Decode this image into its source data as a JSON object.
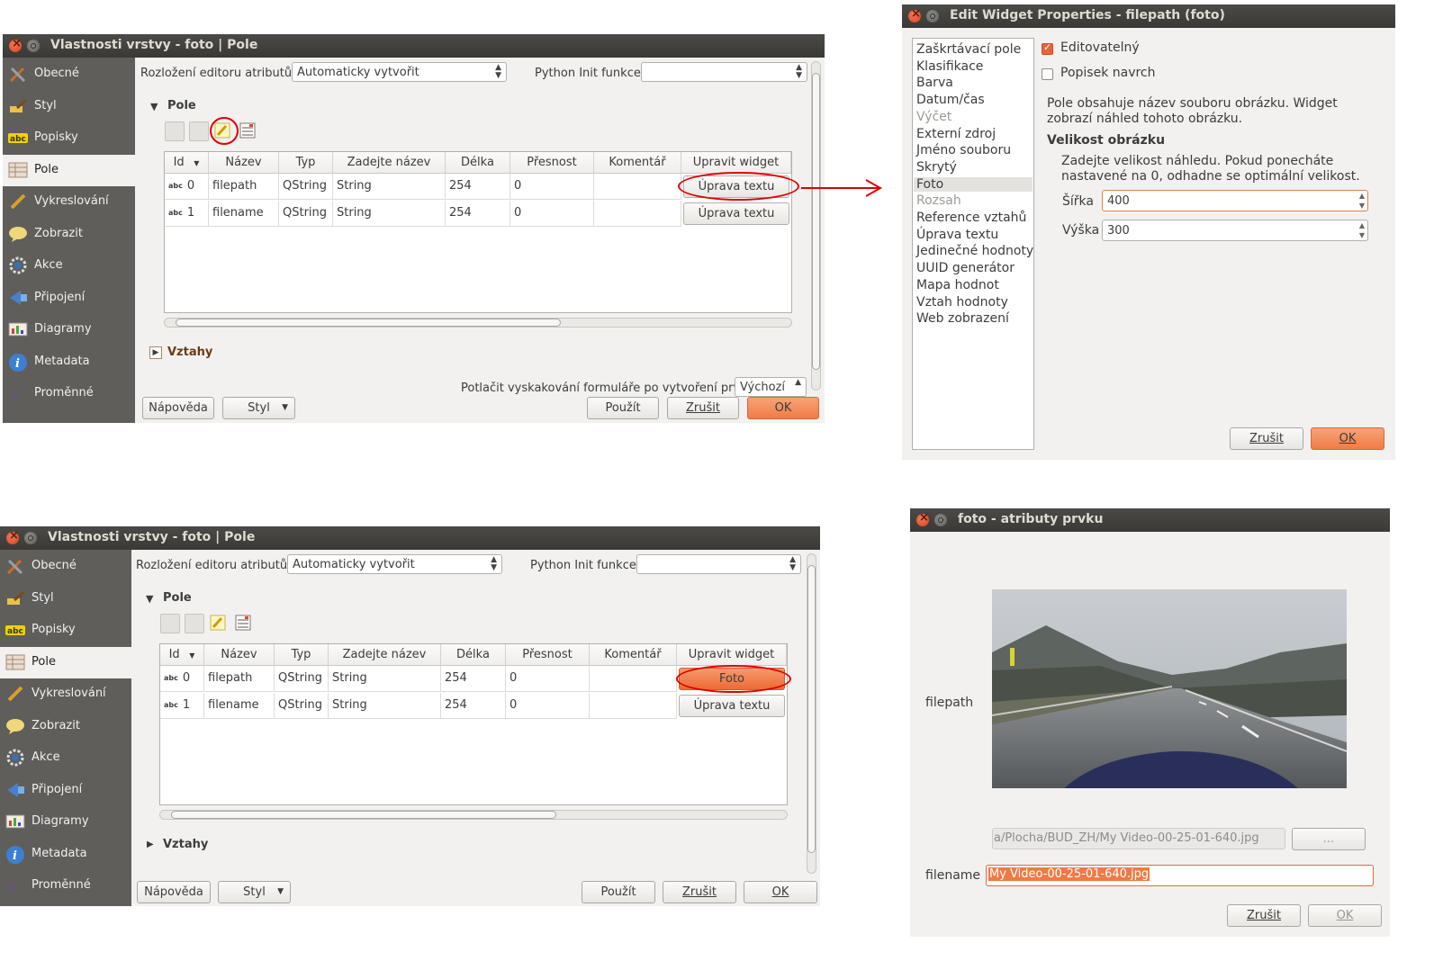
{
  "colors": {
    "titlebar": "#3c3b37",
    "sidebar": "#5f5e5a",
    "accent": "#ef7c46",
    "highlight_ring": "#e00000"
  },
  "win1": {
    "title": "Vlastnosti vrstvy - foto | Pole",
    "sidebar": [
      {
        "label": "Obecné",
        "icon": "tools-icon"
      },
      {
        "label": "Styl",
        "icon": "brush-icon"
      },
      {
        "label": "Popisky",
        "icon": "abc-label-icon"
      },
      {
        "label": "Pole",
        "icon": "table-icon"
      },
      {
        "label": "Vykreslování",
        "icon": "paintbrush-icon"
      },
      {
        "label": "Zobrazit",
        "icon": "speech-bubble-icon"
      },
      {
        "label": "Akce",
        "icon": "gear-icon"
      },
      {
        "label": "Připojení",
        "icon": "join-icon"
      },
      {
        "label": "Diagramy",
        "icon": "diagram-icon"
      },
      {
        "label": "Metadata",
        "icon": "info-icon"
      },
      {
        "label": "Proměnné",
        "icon": "epsilon-icon"
      }
    ],
    "editor_layout_label": "Rozložení editoru atributů:",
    "editor_layout_value": "Automaticky vytvořit",
    "python_init_label": "Python Init funkce",
    "python_init_value": "",
    "section_fields": "Pole",
    "section_relations": "Vztahy",
    "columns": [
      "Id",
      "Název",
      "Typ",
      "Zadejte název",
      "Délka",
      "Přesnost",
      "Komentář",
      "Upravit widget"
    ],
    "rows": [
      {
        "type_badge": "abc",
        "id": "0",
        "name": "filepath",
        "typ": "QString",
        "type_name": "String",
        "length": "254",
        "precision": "0",
        "comment": "",
        "widget": "Úprava textu"
      },
      {
        "type_badge": "abc",
        "id": "1",
        "name": "filename",
        "typ": "QString",
        "type_name": "String",
        "length": "254",
        "precision": "0",
        "comment": "",
        "widget": "Úprava textu"
      }
    ],
    "suppress_label": "Potlačit vyskakování formuláře po vytvoření prvku",
    "suppress_value": "Výchozí",
    "btn_help": "Nápověda",
    "btn_style": "Styl",
    "btn_apply": "Použít",
    "btn_cancel": "Zrušit",
    "btn_ok": "OK"
  },
  "win2": {
    "title": "Vlastnosti vrstvy - foto | Pole",
    "rows": [
      {
        "type_badge": "abc",
        "id": "0",
        "name": "filepath",
        "typ": "QString",
        "type_name": "String",
        "length": "254",
        "precision": "0",
        "comment": "",
        "widget": "Foto"
      },
      {
        "type_badge": "abc",
        "id": "1",
        "name": "filename",
        "typ": "QString",
        "type_name": "String",
        "length": "254",
        "precision": "0",
        "comment": "",
        "widget": "Úprava textu"
      }
    ]
  },
  "widget_dialog": {
    "title": "Edit Widget Properties - filepath (foto)",
    "types": [
      {
        "label": "Zaškrtávací pole",
        "enabled": true
      },
      {
        "label": "Klasifikace",
        "enabled": true
      },
      {
        "label": "Barva",
        "enabled": true
      },
      {
        "label": "Datum/čas",
        "enabled": true
      },
      {
        "label": "Výčet",
        "enabled": false
      },
      {
        "label": "Externí zdroj",
        "enabled": true
      },
      {
        "label": "Jméno souboru",
        "enabled": true
      },
      {
        "label": "Skrytý",
        "enabled": true
      },
      {
        "label": "Foto",
        "enabled": true,
        "selected": true
      },
      {
        "label": "Rozsah",
        "enabled": false
      },
      {
        "label": "Reference vztahů",
        "enabled": true
      },
      {
        "label": "Úprava textu",
        "enabled": true
      },
      {
        "label": "Jedinečné hodnoty",
        "enabled": true
      },
      {
        "label": "UUID generátor",
        "enabled": true
      },
      {
        "label": "Mapa hodnot",
        "enabled": true
      },
      {
        "label": "Vztah hodnoty",
        "enabled": true
      },
      {
        "label": "Web zobrazení",
        "enabled": true
      }
    ],
    "editable_label": "Editovatelný",
    "editable_checked": true,
    "label_on_top_label": "Popisek navrch",
    "label_on_top_checked": false,
    "description": "Pole obsahuje název souboru obrázku. Widget zobrazí náhled tohoto obrázku.",
    "size_heading": "Velikost obrázku",
    "size_hint": "Zadejte velikost náhledu. Pokud ponecháte nastavené na 0, odhadne se optimální velikost.",
    "width_label": "Šířka",
    "width_value": "400",
    "height_label": "Výška",
    "height_value": "300",
    "btn_cancel": "Zrušit",
    "btn_ok": "OK"
  },
  "feature_form": {
    "title": "foto - atributy prvku",
    "filepath_label": "filepath",
    "filepath_value": "a/Plocha/BUD_ZH/My Video-00-25-01-640.jpg",
    "browse_label": "...",
    "filename_label": "filename",
    "filename_value": "My Video-00-25-01-640.jpg",
    "btn_cancel": "Zrušit",
    "btn_ok": "OK"
  }
}
